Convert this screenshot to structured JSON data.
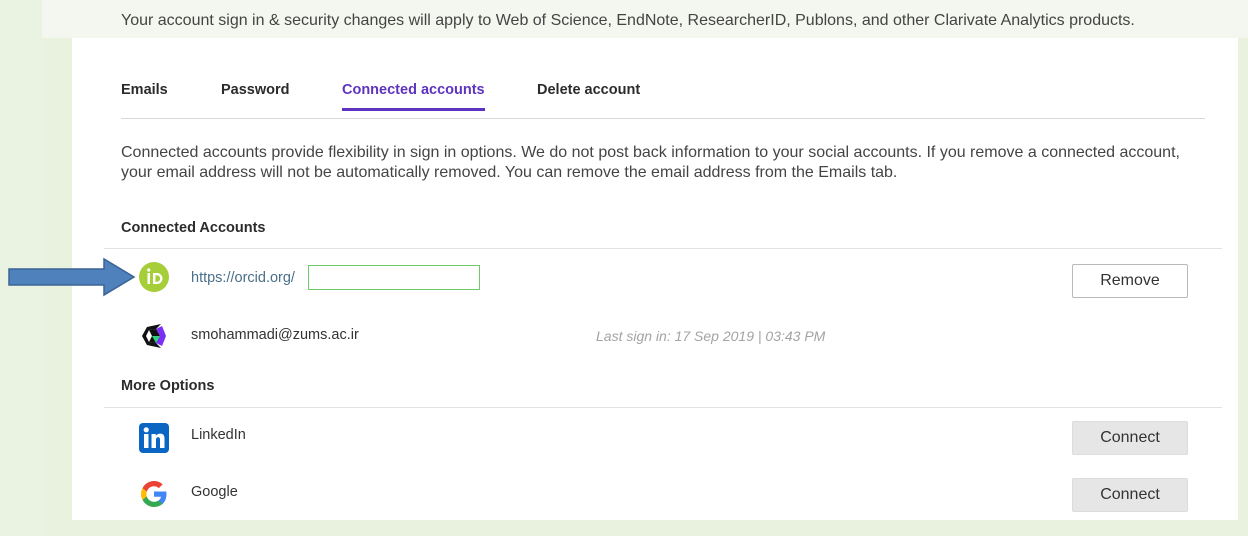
{
  "intro_text": "Your account sign in & security changes will apply to Web of Science, EndNote, ResearcherID, Publons, and other Clarivate Analytics products.",
  "tabs": [
    {
      "label": "Emails"
    },
    {
      "label": "Password"
    },
    {
      "label": "Connected accounts",
      "active": true
    },
    {
      "label": "Delete account"
    }
  ],
  "description": "Connected accounts provide flexibility in sign in options. We do not post back information to your social accounts. If you remove a connected account, your email address will not be automatically removed. You can remove the email address from the Emails tab.",
  "connected": {
    "title": "Connected Accounts",
    "items": [
      {
        "icon": "orcid-icon",
        "text": "https://orcid.org/",
        "button": "Remove"
      },
      {
        "icon": "clarivate-icon",
        "text": "smohammadi@zums.ac.ir",
        "last_signin": "Last sign in: 17 Sep 2019 | 03:43 PM"
      }
    ]
  },
  "more_options": {
    "title": "More Options",
    "items": [
      {
        "icon": "linkedin-icon",
        "text": "LinkedIn",
        "button": "Connect"
      },
      {
        "icon": "google-icon",
        "text": "Google",
        "button": "Connect"
      }
    ]
  },
  "colors": {
    "accent": "#5e33bf",
    "orcid": "#a6ce39",
    "linkedin": "#0a66c2",
    "arrow": "#4f81bd"
  }
}
